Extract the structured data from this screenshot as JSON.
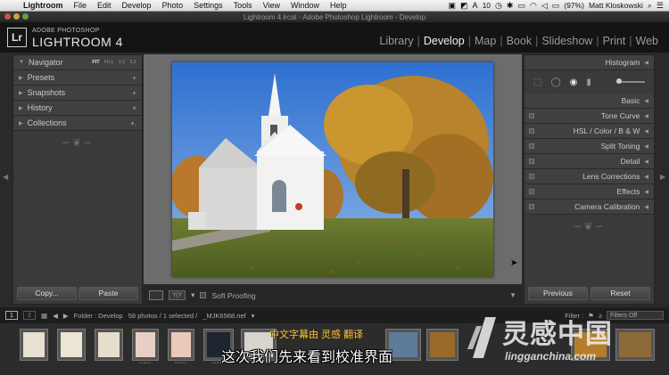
{
  "menubar": {
    "app": "Lightroom",
    "items": [
      "File",
      "Edit",
      "Develop",
      "Photo",
      "Settings",
      "Tools",
      "View",
      "Window",
      "Help"
    ],
    "status_count": "10",
    "battery": "(97%)",
    "user": "Matt Kloskowski"
  },
  "window": {
    "title": "Lightroom 4.lrcat - Adobe Photoshop Lightroom - Develop"
  },
  "identity": {
    "logo": "Lr",
    "product_small": "ADOBE PHOTOSHOP",
    "product_big": "LIGHTROOM 4",
    "modules": [
      "Library",
      "Develop",
      "Map",
      "Book",
      "Slideshow",
      "Print",
      "Web"
    ],
    "active_module": "Develop"
  },
  "left_panel": {
    "navigator": {
      "label": "Navigator",
      "zoom_options": [
        "FIT",
        "FILL",
        "1:1",
        "3:1"
      ]
    },
    "sections": [
      {
        "label": "Presets",
        "action": "+"
      },
      {
        "label": "Snapshots",
        "action": "+"
      },
      {
        "label": "History",
        "action": "×"
      },
      {
        "label": "Collections",
        "action": "+."
      }
    ],
    "copy_button": "Copy...",
    "paste_button": "Paste"
  },
  "right_panel": {
    "histogram_label": "Histogram",
    "sections": [
      "Basic",
      "Tone Curve",
      "HSL  /  Color  /  B & W",
      "Split Toning",
      "Detail",
      "Lens Corrections",
      "Effects",
      "Camera Calibration"
    ],
    "previous_button": "Previous",
    "reset_button": "Reset"
  },
  "center_toolbar": {
    "yy_label": "Y|Y",
    "soft_proofing": "Soft Proofing"
  },
  "filmstrip_bar": {
    "page1": "1",
    "page2": "2",
    "folder": "Folder : Develop",
    "count": "58 photos / 1 selected /",
    "filename": "_MJK6568.nef",
    "filter_label": "Filter :",
    "filter_value": "Filters Off"
  },
  "overlay": {
    "subtitle": "这次我们先来看到校准界面",
    "credit": "中文字幕由 灵感 翻译",
    "watermark": "灵感中国",
    "watermark_url": "lingganchina.com"
  }
}
